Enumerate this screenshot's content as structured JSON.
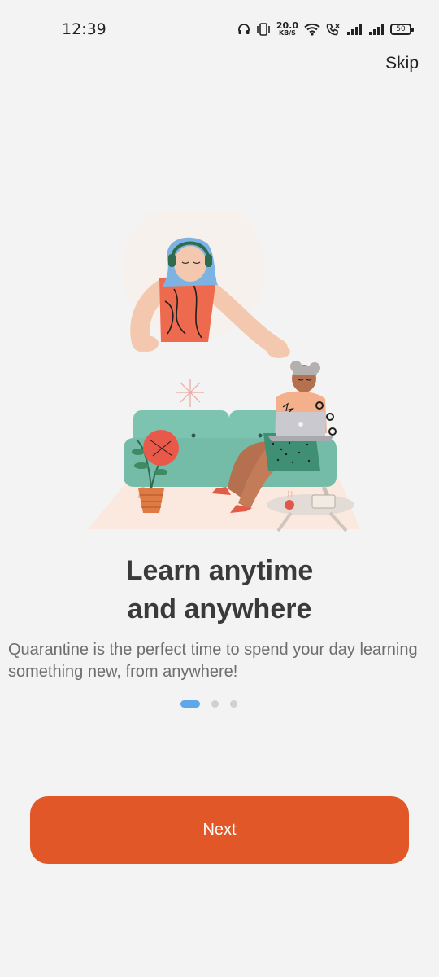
{
  "status_bar": {
    "time": "12:39",
    "net_speed_value": "20.0",
    "net_speed_unit": "KB/S",
    "battery_level": "50",
    "icons": [
      "headphones-icon",
      "vibrate-icon",
      "wifi-icon",
      "call-icon",
      "signal-icon",
      "signal-icon",
      "battery-icon"
    ]
  },
  "header": {
    "skip_label": "Skip"
  },
  "onboarding": {
    "title_line1": "Learn anytime",
    "title_line2": "and anywhere",
    "description": "Quarantine is the perfect time to spend your day learning something new, from anywhere!",
    "page_indicator": {
      "current": 1,
      "total": 3
    }
  },
  "footer": {
    "next_label": "Next"
  },
  "colors": {
    "accent": "#e25728",
    "indicator_active": "#5ea7e8",
    "indicator_inactive": "#d0d0d0",
    "background": "#f3f3f3"
  }
}
